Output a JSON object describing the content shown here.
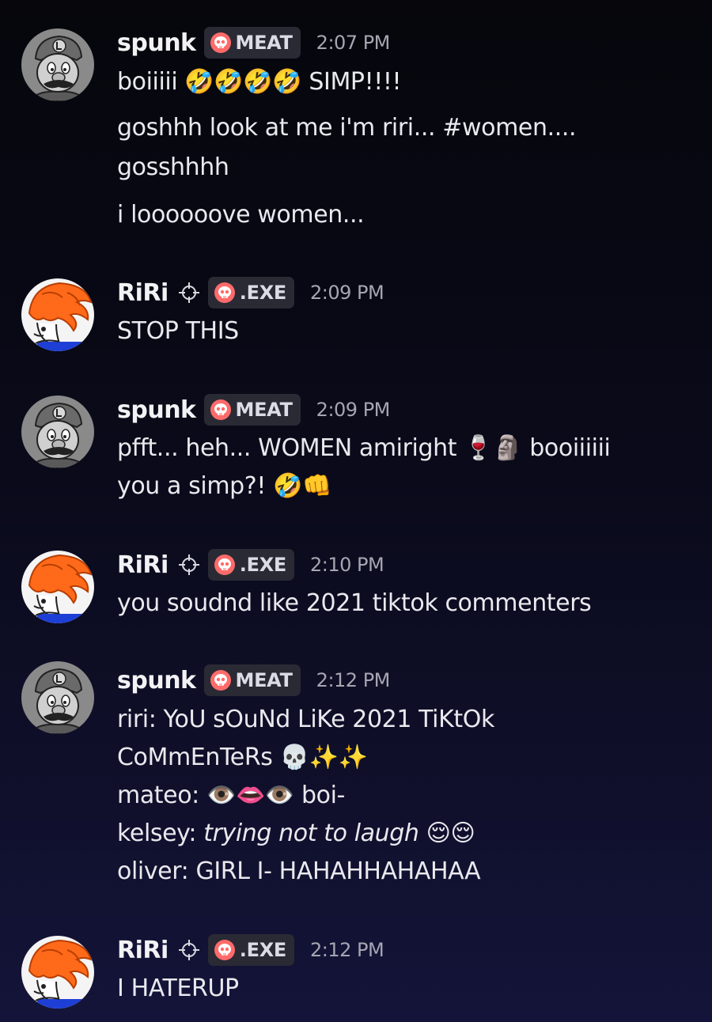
{
  "messages": [
    {
      "username": "spunk",
      "avatar_icon": "luigi-avatar-icon",
      "role": ".MEAT",
      "role_display": "MEAT",
      "timestamp": "2:07 PM",
      "lines": [
        "boiiiii 🤣🤣🤣🤣 SIMP!!!!",
        "goshhh look at me i'm riri... #women....",
        "gosshhhh",
        "i loooooove women..."
      ]
    },
    {
      "username": "RiRi",
      "avatar_icon": "riri-avatar-icon",
      "role": ".EXE",
      "timestamp": "2:09 PM",
      "lines": [
        "STOP THIS"
      ]
    },
    {
      "username": "spunk",
      "avatar_icon": "luigi-avatar-icon",
      "role_display": "MEAT",
      "timestamp": "2:09 PM",
      "lines": [
        "pfft... heh... WOMEN amiright 🍷🗿 booiiiiii",
        "you a simp?! 🤣👊"
      ]
    },
    {
      "username": "RiRi",
      "avatar_icon": "riri-avatar-icon",
      "role": ".EXE",
      "timestamp": "2:10 PM",
      "lines": [
        "you soudnd like 2021 tiktok commenters"
      ]
    },
    {
      "username": "spunk",
      "avatar_icon": "luigi-avatar-icon",
      "role_display": "MEAT",
      "timestamp": "2:12 PM",
      "lines": [
        "riri: YoU sOuNd LiKe 2021 TiKtOk",
        "CoMmEnTeRs 💀✨✨",
        "mateo: 👁️👄👁️ boi-",
        "kelsey: ",
        "trying not to laugh",
        " 😌😌",
        "oliver: GIRL I- HAHAHHAHAHAA"
      ]
    },
    {
      "username": "RiRi",
      "avatar_icon": "riri-avatar-icon",
      "role": ".EXE",
      "timestamp": "2:12 PM",
      "lines": [
        "I HATERUP"
      ]
    }
  ],
  "colors": {
    "background_top": "#06060c",
    "background_bottom": "#14143a",
    "role_tag_bg": "#2a2a35",
    "skull": "#ff6b6b",
    "text": "#e9e9ee",
    "timestamp": "#a6a6b2"
  }
}
